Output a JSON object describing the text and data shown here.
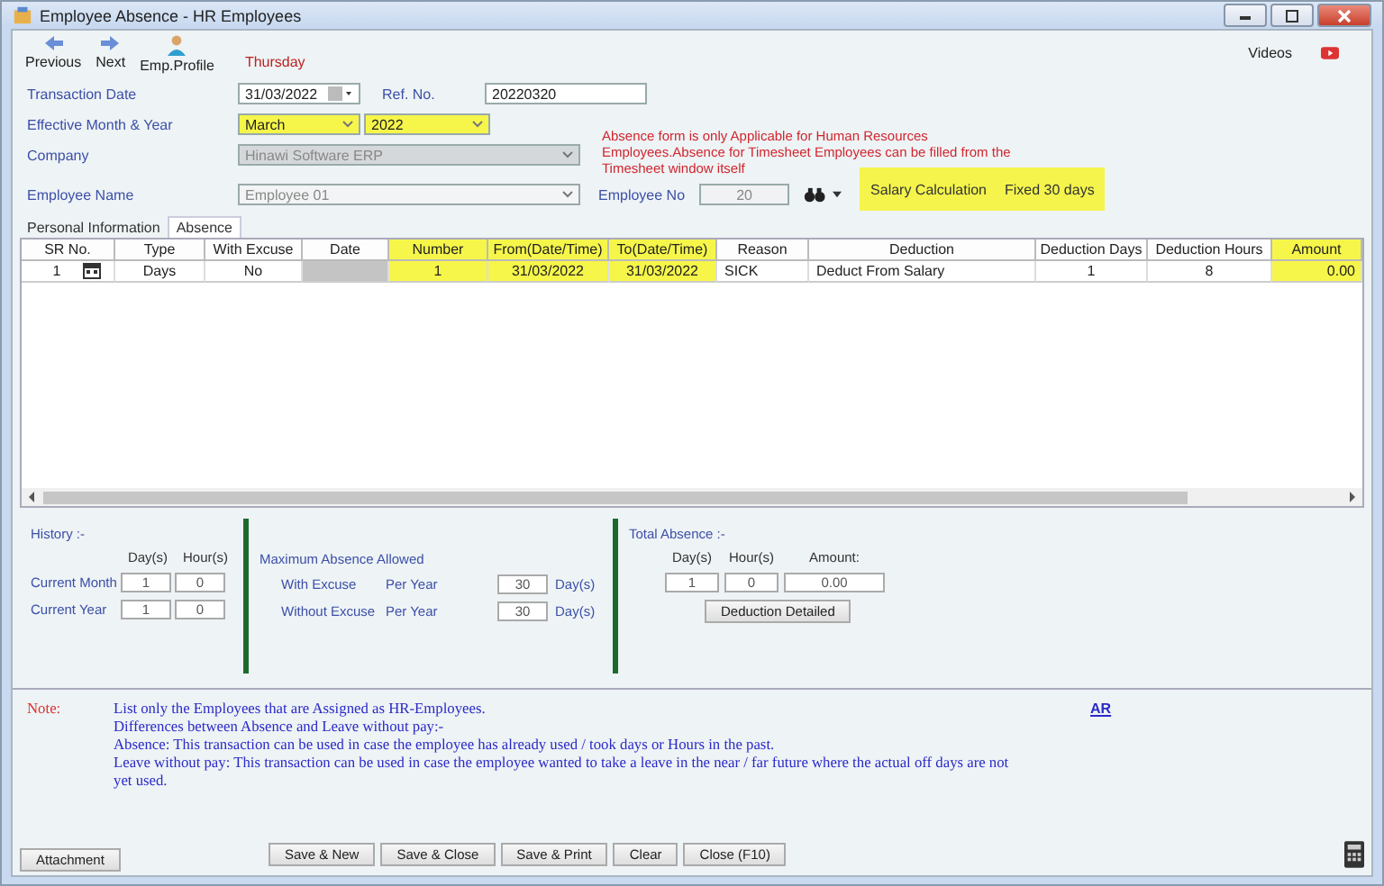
{
  "window": {
    "title": "Employee Absence - HR Employees"
  },
  "toolbar": [
    {
      "label": "Previous",
      "kind": "prev"
    },
    {
      "label": "Next",
      "kind": "next"
    },
    {
      "label": "Emp.Profile",
      "kind": "profile"
    }
  ],
  "day_label": "Thursday",
  "videos": {
    "label": "Videos"
  },
  "form": {
    "transaction_date_label": "Transaction Date",
    "transaction_date": "31/03/2022",
    "ref_label": "Ref. No.",
    "ref_no": "20220320",
    "month_label": "Effective Month & Year",
    "month": "March",
    "year": "2022",
    "company_label": "Company",
    "company": "Hinawi Software ERP",
    "employee_label": "Employee Name",
    "employee": "Employee 01",
    "employee_no_label": "Employee No",
    "employee_no": "20"
  },
  "notice": "Absence form is only Applicable for Human Resources Employees.Absence for Timesheet Employees can be filled from the Timesheet window itself",
  "salary": {
    "label": "Salary Calculation",
    "value": "Fixed 30 days"
  },
  "tabs": [
    {
      "label": "Personal Information",
      "selected": false
    },
    {
      "label": "Absence",
      "selected": true
    }
  ],
  "table": {
    "columns": [
      {
        "label": "SR No.",
        "highlighted": false
      },
      {
        "label": "Type",
        "highlighted": false
      },
      {
        "label": "With Excuse",
        "highlighted": false
      },
      {
        "label": "Date",
        "highlighted": false
      },
      {
        "label": "Number",
        "highlighted": true
      },
      {
        "label": "From(Date/Time)",
        "highlighted": true
      },
      {
        "label": "To(Date/Time)",
        "highlighted": true
      },
      {
        "label": "Reason",
        "highlighted": false
      },
      {
        "label": "Deduction",
        "highlighted": false
      },
      {
        "label": "Deduction Days",
        "highlighted": false
      },
      {
        "label": "Deduction Hours",
        "highlighted": false
      },
      {
        "label": "Amount",
        "highlighted": true
      }
    ],
    "rows": [
      {
        "cells": [
          "1",
          "Days",
          "No",
          null,
          "1",
          "31/03/2022",
          "31/03/2022",
          "SICK",
          "Deduct From Salary",
          "1",
          "8",
          "0.00"
        ]
      }
    ]
  },
  "history": {
    "title": "History :-",
    "headers": [
      "Day(s)",
      "Hour(s)"
    ],
    "rows": [
      {
        "label": "Current Month",
        "days": "1",
        "hours": "0"
      },
      {
        "label": "Current Year",
        "days": "1",
        "hours": "0"
      }
    ]
  },
  "maximum": {
    "title": "Maximum Absence Allowed",
    "rows": [
      {
        "label": "With Excuse",
        "period": "Per Year",
        "value": "30",
        "unit": "Day(s)"
      },
      {
        "label": "Without Excuse",
        "period": "Per Year",
        "value": "30",
        "unit": "Day(s)"
      }
    ]
  },
  "total": {
    "title": "Total Absence :-",
    "headers": [
      "Day(s)",
      "Hour(s)",
      "Amount:"
    ],
    "values": [
      "1",
      "0",
      "0.00"
    ],
    "button": "Deduction Detailed"
  },
  "note": {
    "label": "Note:",
    "lines": [
      "List only the Employees that are Assigned as HR-Employees.",
      "Differences between Absence and Leave without pay:-",
      "Absence: This transaction can be used in case the employee has already used / took days or Hours in the past.",
      "Leave without pay: This transaction can be used in case the employee wanted to take a leave in the near / far future where the actual off days are not yet used."
    ],
    "link": "AR"
  },
  "footer": {
    "attachment": "Attachment",
    "buttons": [
      "Save & New",
      "Save & Close",
      "Save & Print",
      "Clear",
      "Close (F10)"
    ]
  }
}
